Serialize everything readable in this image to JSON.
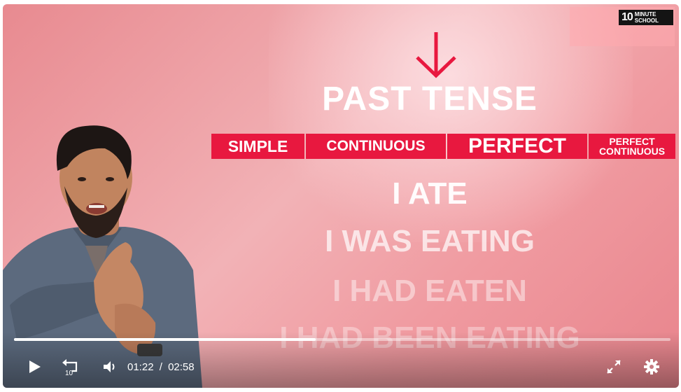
{
  "logo": {
    "num": "10",
    "line1": "MINUTE",
    "line2": "SCHOOL"
  },
  "slide": {
    "title": "PAST TENSE",
    "tabs": [
      "SIMPLE",
      "CONTINUOUS",
      "PERFECT",
      "PERFECT",
      "CONTINUOUS"
    ],
    "sentences": [
      "I ATE",
      "I WAS EATING",
      "I HAD EATEN",
      "I HAD BEEN EATING"
    ]
  },
  "player": {
    "current_time": "01:22",
    "separator": "/",
    "duration": "02:58",
    "progress_fraction": 0.46,
    "replay_seconds": "10"
  },
  "colors": {
    "accent": "#e8183f"
  }
}
